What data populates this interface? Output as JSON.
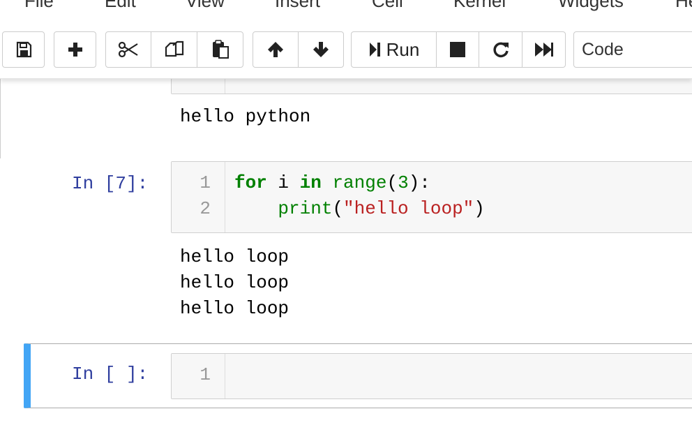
{
  "menubar": {
    "items": [
      "File",
      "Edit",
      "View",
      "Insert",
      "Cell",
      "Kernel",
      "Widgets",
      "Help"
    ]
  },
  "toolbar": {
    "save_icon": "floppy-disk-icon",
    "insert_icon": "plus-icon",
    "cut_icon": "scissors-icon",
    "copy_icon": "copy-icon",
    "paste_icon": "paste-icon",
    "move_up_icon": "arrow-up-icon",
    "move_down_icon": "arrow-down-icon",
    "run_label": "Run",
    "interrupt_icon": "stop-icon",
    "restart_icon": "restart-icon",
    "restart_run_all_icon": "fast-forward-icon",
    "cell_type": "Code"
  },
  "notebook": {
    "cell_top": {
      "output": "hello python"
    },
    "cell_7": {
      "prompt": "In [7]:",
      "line_numbers": [
        "1",
        "2"
      ],
      "code": {
        "line1": {
          "kw_for": "for",
          "var": " i ",
          "kw_in": "in",
          "sp": " ",
          "builtin": "range",
          "open": "(",
          "num": "3",
          "close": "):"
        },
        "line2": {
          "indent": "    ",
          "builtin": "print",
          "open": "(",
          "str": "\"hello loop\"",
          "close": ")"
        }
      },
      "outputs": [
        "hello loop",
        "hello loop",
        "hello loop"
      ]
    },
    "cell_empty": {
      "prompt": "In [ ]:",
      "line_numbers": [
        "1"
      ]
    }
  },
  "colors": {
    "prompt": "#303f9f",
    "keyword": "#008000",
    "string": "#ba2121",
    "selected_bar": "#42a5f5"
  }
}
